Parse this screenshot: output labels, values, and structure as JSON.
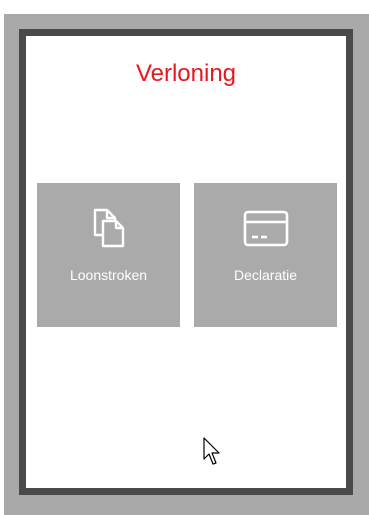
{
  "app": {
    "title": "Verloning"
  },
  "tiles": [
    {
      "label": "Loonstroken",
      "icon": "documents-icon"
    },
    {
      "label": "Declaratie",
      "icon": "card-icon"
    }
  ],
  "colors": {
    "title": "#e8171f",
    "tile_background": "#aaaaaa",
    "frame_outer": "#a9a9a9",
    "frame_inner": "#4a4a4a"
  }
}
